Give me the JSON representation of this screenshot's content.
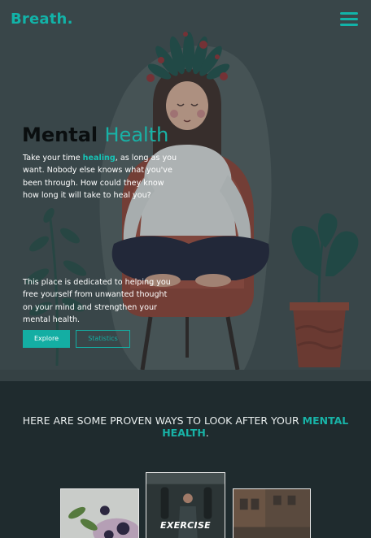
{
  "brand": {
    "logo": "Breath."
  },
  "header": {
    "menu_icon": "hamburger-menu-icon"
  },
  "hero": {
    "title_bold": "Mental",
    "title_light": "Health",
    "p1_before": "Take your time ",
    "p1_highlight": "healing",
    "p1_after": ", as long as you want. Nobody else knows what you've been through. How could they know how long it will take to heal you?",
    "p2": "This place is dedicated to helping you free yourself from unwanted thought on your mind and strengthen your mental health.",
    "explore_label": "Explore",
    "stats_label": "Statistics"
  },
  "ways": {
    "heading_before": "HERE ARE SOME PROVEN WAYS TO LOOK AFTER YOUR ",
    "heading_accent": "MENTAL HEALTH",
    "heading_after": ".",
    "cards": [
      {
        "label": ""
      },
      {
        "label": "EXERCISE"
      },
      {
        "label": ""
      }
    ]
  },
  "colors": {
    "accent": "#14aea3",
    "hero_bg": "#3d4a4d",
    "section_bg": "#1f2b2e"
  }
}
